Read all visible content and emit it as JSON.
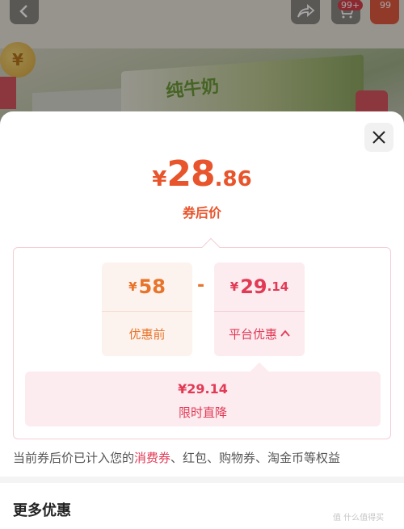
{
  "background": {
    "cart_badge": "99+",
    "more_badge": "99",
    "product_title": "纯牛奶"
  },
  "price": {
    "currency": "¥",
    "integer": "28",
    "decimal": ".86",
    "label": "券后价"
  },
  "breakdown": {
    "original": {
      "currency": "¥",
      "amount": "58",
      "label": "优惠前"
    },
    "operator": "-",
    "platform": {
      "currency": "¥",
      "integer": "29",
      "decimal": ".14",
      "label": "平台优惠"
    },
    "limited": {
      "amount": "¥29.14",
      "label": "限时直降"
    }
  },
  "note": {
    "prefix": "当前券后价已计入您的",
    "link": "消费券",
    "suffix": "、红包、购物券、淘金币等权益"
  },
  "more_offers": {
    "title": "更多优惠"
  },
  "watermark": "值 什么值得买",
  "colors": {
    "accent_orange": "#e8542b",
    "accent_red": "#e23a55"
  }
}
